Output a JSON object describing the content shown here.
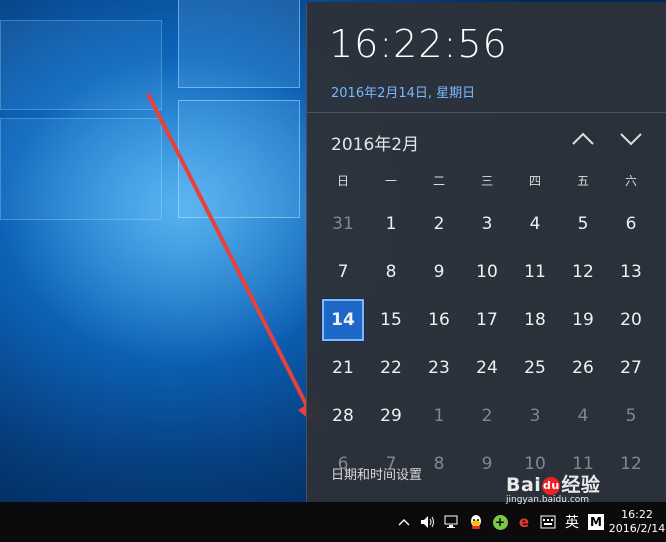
{
  "flyout": {
    "time": "16:22:56",
    "date": "2016年2月14日, 星期日",
    "month_label": "2016年2月",
    "weekdays": [
      "日",
      "一",
      "二",
      "三",
      "四",
      "五",
      "六"
    ],
    "days": [
      {
        "label": "31",
        "dim": true
      },
      {
        "label": "1"
      },
      {
        "label": "2"
      },
      {
        "label": "3"
      },
      {
        "label": "4"
      },
      {
        "label": "5"
      },
      {
        "label": "6"
      },
      {
        "label": "7"
      },
      {
        "label": "8"
      },
      {
        "label": "9"
      },
      {
        "label": "10"
      },
      {
        "label": "11"
      },
      {
        "label": "12"
      },
      {
        "label": "13"
      },
      {
        "label": "14",
        "today": true
      },
      {
        "label": "15"
      },
      {
        "label": "16"
      },
      {
        "label": "17"
      },
      {
        "label": "18"
      },
      {
        "label": "19"
      },
      {
        "label": "20"
      },
      {
        "label": "21"
      },
      {
        "label": "22"
      },
      {
        "label": "23"
      },
      {
        "label": "24"
      },
      {
        "label": "25"
      },
      {
        "label": "26"
      },
      {
        "label": "27"
      },
      {
        "label": "28"
      },
      {
        "label": "29"
      },
      {
        "label": "1",
        "dim": true
      },
      {
        "label": "2",
        "dim": true
      },
      {
        "label": "3",
        "dim": true
      },
      {
        "label": "4",
        "dim": true
      },
      {
        "label": "5",
        "dim": true
      },
      {
        "label": "6",
        "dim": true
      },
      {
        "label": "7",
        "dim": true
      },
      {
        "label": "8",
        "dim": true
      },
      {
        "label": "9",
        "dim": true
      },
      {
        "label": "10",
        "dim": true
      },
      {
        "label": "11",
        "dim": true
      },
      {
        "label": "12",
        "dim": true
      }
    ],
    "settings_link": "日期和时间设置"
  },
  "taskbar": {
    "ime_label": "英",
    "m_label": "M",
    "clock_time": "16:22",
    "clock_date": "2016/2/14",
    "icons": [
      "chevron-up-icon",
      "speaker-icon",
      "network-icon",
      "qq-icon",
      "green-plus-icon",
      "red-e-icon",
      "keyboard-icon"
    ]
  },
  "watermark": {
    "logo_left": "Bai",
    "logo_paw": "du",
    "logo_right": "经验",
    "url": "jingyan.baidu.com"
  },
  "colors": {
    "accent_date": "#79b8ff",
    "today_bg": "#1d68c7",
    "annotation_red": "#e8403a"
  }
}
